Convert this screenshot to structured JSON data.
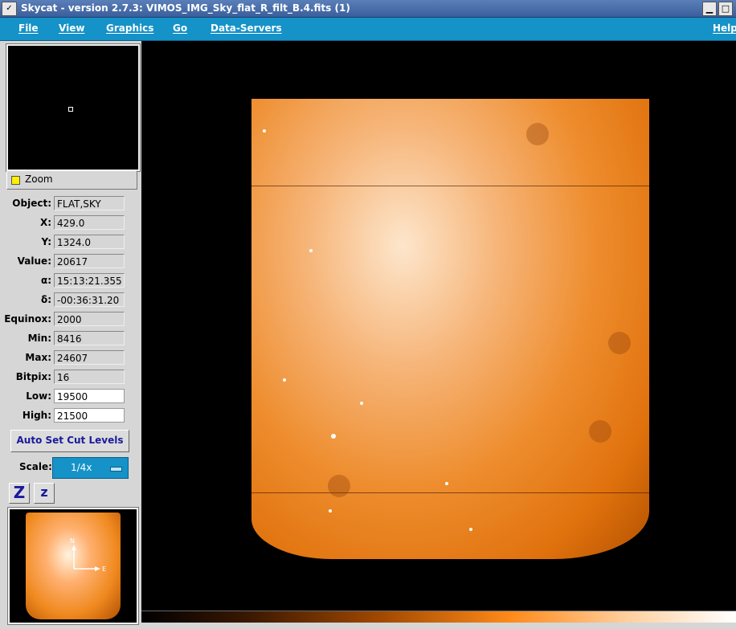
{
  "window": {
    "title": "Skycat - version 2.7.3: VIMOS_IMG_Sky_flat_R_filt_B.4.fits (1)",
    "system_menu_glyph": "✓",
    "minimize_glyph": "▁",
    "maximize_glyph": "□"
  },
  "menubar": {
    "file": "File",
    "view": "View",
    "graphics": "Graphics",
    "go": "Go",
    "data_servers": "Data-Servers",
    "help": "Help"
  },
  "zoom": {
    "label": "Zoom",
    "checked": true
  },
  "info": [
    {
      "key": "Object:",
      "value": "FLAT,SKY"
    },
    {
      "key": "X:",
      "value": "429.0"
    },
    {
      "key": "Y:",
      "value": "1324.0"
    },
    {
      "key": "Value:",
      "value": "20617"
    },
    {
      "key": "α:",
      "value": "15:13:21.355"
    },
    {
      "key": "δ:",
      "value": "-00:36:31.20"
    },
    {
      "key": "Equinox:",
      "value": "2000"
    },
    {
      "key": "Min:",
      "value": "8416"
    },
    {
      "key": "Max:",
      "value": "24607"
    },
    {
      "key": "Bitpix:",
      "value": "16"
    },
    {
      "key": "Low:",
      "value": "19500"
    },
    {
      "key": "High:",
      "value": "21500"
    }
  ],
  "buttons": {
    "auto_cut": "Auto Set Cut Levels",
    "zoom_in": "Z",
    "zoom_out": "z"
  },
  "scale": {
    "label": "Scale:",
    "value": "1/4x"
  },
  "thumbnail": {
    "north_label": "N",
    "east_label": "E"
  },
  "colors": {
    "menubar": "#1592c8",
    "image_orange": "#ee8d2e",
    "highlight_yellow": "#ffef00"
  },
  "icons": {
    "system_menu": "checkmark-icon",
    "minimize": "minimize-icon",
    "maximize": "maximize-icon",
    "zoom_toggle": "checkbox-icon",
    "scale_dropdown": "dropdown-indicator-icon"
  }
}
